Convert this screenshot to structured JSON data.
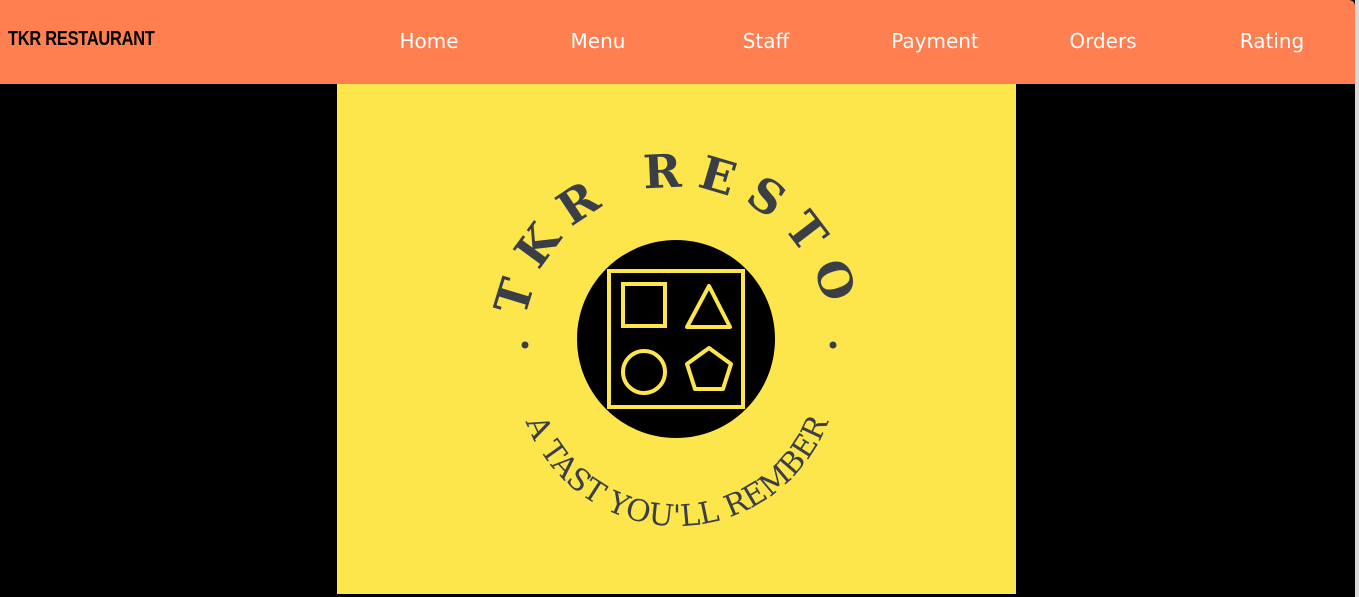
{
  "navbar": {
    "brand": "TKR RESTAURANT",
    "links": [
      "Home",
      "Menu",
      "Staff",
      "Payment",
      "Orders",
      "Rating"
    ]
  },
  "logo": {
    "top_text": "TKR RESTO",
    "bottom_text": "A TAST YOU'LL REMBER"
  },
  "colors": {
    "navbar": "#FF7F50",
    "panel": "#FDE54C",
    "logo_text": "#3a3f47",
    "emblem": "#000000",
    "emblem_shapes": "#FDE54C"
  }
}
